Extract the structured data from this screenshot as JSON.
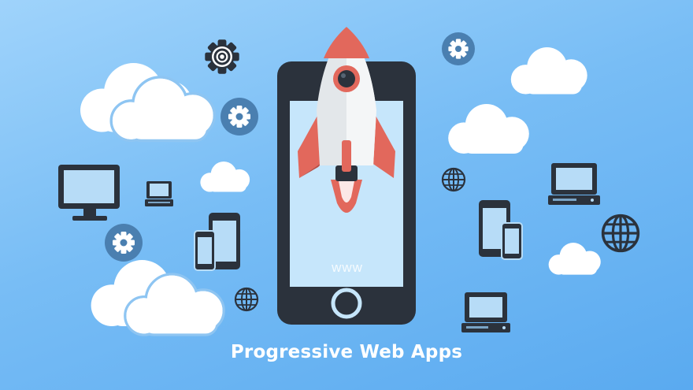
{
  "caption": "Progressive Web Apps",
  "phone_screen_text": "www",
  "icons": {
    "rocket": "rocket-icon",
    "phone": "smartphone-icon",
    "gear": "gear-icon",
    "cloud": "cloud-icon",
    "monitor": "desktop-monitor-icon",
    "laptop": "laptop-icon",
    "globe": "globe-icon",
    "devices": "phone-tablet-icon"
  },
  "colors": {
    "background_top": "#9fd3fb",
    "background_bottom": "#5aaaf0",
    "device_dark": "#2b323c",
    "phone_screen": "#c6e6fb",
    "rocket_red": "#e2685c",
    "rocket_body": "#eceff1",
    "gear_badge": "#4a7fb0",
    "cloud": "#ffffff"
  }
}
